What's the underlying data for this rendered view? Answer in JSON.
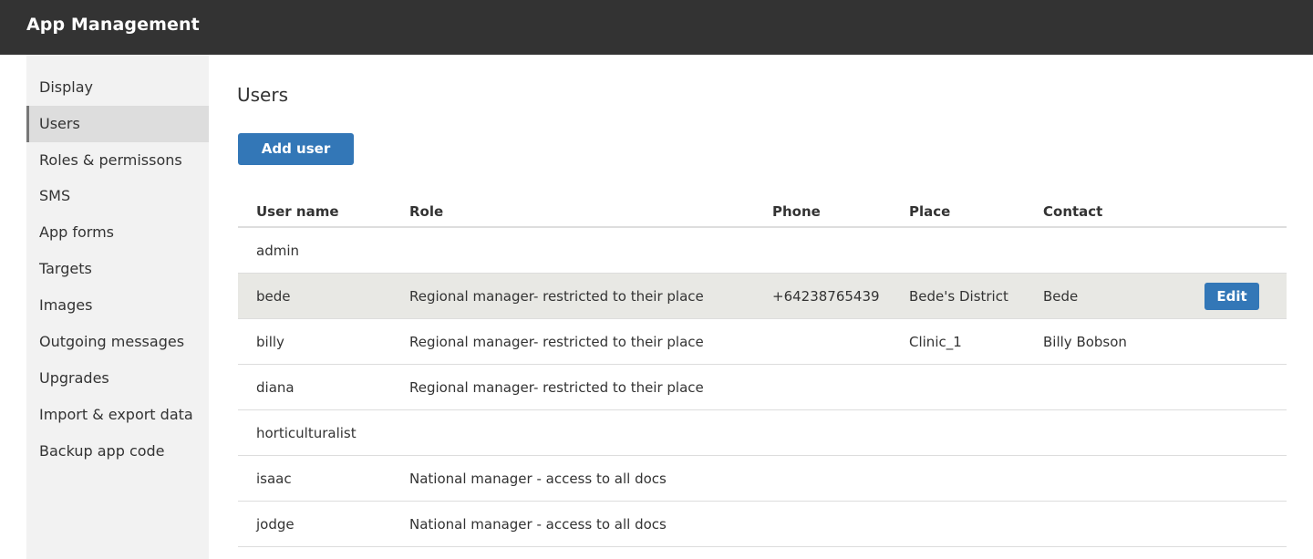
{
  "header": {
    "title": "App Management"
  },
  "sidebar": {
    "items": [
      {
        "label": "Display"
      },
      {
        "label": "Users"
      },
      {
        "label": "Roles & permissons"
      },
      {
        "label": "SMS"
      },
      {
        "label": "App forms"
      },
      {
        "label": "Targets"
      },
      {
        "label": "Images"
      },
      {
        "label": "Outgoing messages"
      },
      {
        "label": "Upgrades"
      },
      {
        "label": "Import & export data"
      },
      {
        "label": "Backup app code"
      }
    ],
    "active": "Users"
  },
  "main": {
    "title": "Users",
    "add_button": "Add user",
    "edit_button": "Edit",
    "columns": {
      "user": "User name",
      "role": "Role",
      "phone": "Phone",
      "place": "Place",
      "contact": "Contact"
    },
    "rows": [
      {
        "user": "admin",
        "role": "",
        "phone": "",
        "place": "",
        "contact": ""
      },
      {
        "user": "bede",
        "role": "Regional manager- restricted to their place",
        "phone": "+64238765439",
        "place": "Bede's District",
        "contact": "Bede"
      },
      {
        "user": "billy",
        "role": "Regional manager- restricted to their place",
        "phone": "",
        "place": "Clinic_1",
        "contact": "Billy Bobson"
      },
      {
        "user": "diana",
        "role": "Regional manager- restricted to their place",
        "phone": "",
        "place": "",
        "contact": ""
      },
      {
        "user": "horticulturalist",
        "role": "",
        "phone": "",
        "place": "",
        "contact": ""
      },
      {
        "user": "isaac",
        "role": "National manager - access to all docs",
        "phone": "",
        "place": "",
        "contact": ""
      },
      {
        "user": "jodge",
        "role": "National manager - access to all docs",
        "phone": "",
        "place": "",
        "contact": ""
      }
    ]
  },
  "colors": {
    "header_bg": "#333333",
    "accent": "#3377b7",
    "sidebar_bg": "#f2f2f2",
    "sidebar_active_bg": "#dddddd",
    "row_hover_bg": "#e8e8e4"
  }
}
